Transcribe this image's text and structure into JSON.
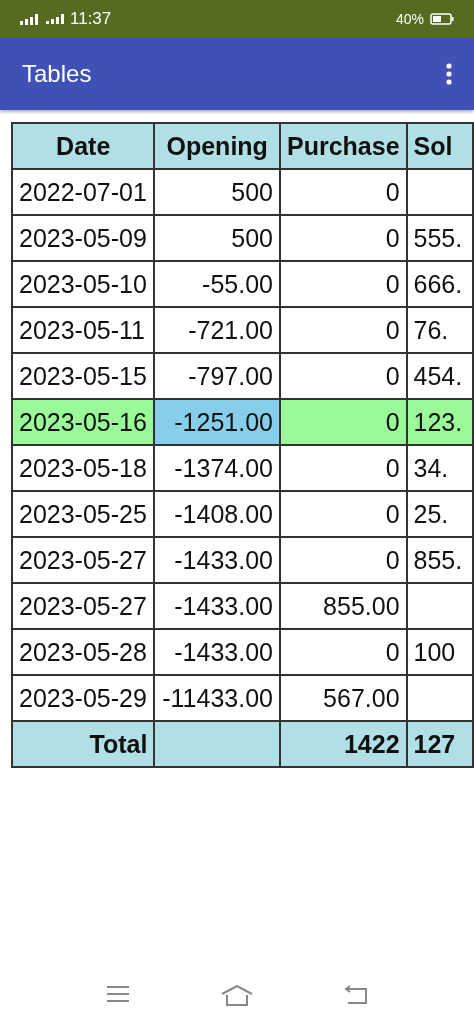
{
  "status_bar": {
    "time": "11:37",
    "battery": "40%"
  },
  "app_bar": {
    "title": "Tables"
  },
  "table": {
    "columns": [
      "Date",
      "Opening",
      "Purchase",
      "Sol"
    ],
    "rows": [
      {
        "date": "2022-07-01",
        "opening": "500",
        "purchase": "0",
        "selected": false,
        "opening_selected": false
      },
      {
        "date": "2023-05-09",
        "opening": "500",
        "purchase": "0",
        "column_4": "555.",
        "selected": false,
        "opening_selected": false
      },
      {
        "date": "2023-05-10",
        "opening": "-55.00",
        "purchase": "0",
        "column_4": "666.",
        "selected": false,
        "opening_selected": false
      },
      {
        "date": "2023-05-11",
        "opening": "-721.00",
        "purchase": "0",
        "column_4": "76.",
        "selected": false,
        "opening_selected": false
      },
      {
        "date": "2023-05-15",
        "opening": "-797.00",
        "purchase": "0",
        "column_4": "454.",
        "selected": false,
        "opening_selected": false
      },
      {
        "date": "2023-05-16",
        "opening": "-1251.00",
        "purchase": "0",
        "column_4": "123.",
        "selected": true,
        "opening_selected": true
      },
      {
        "date": "2023-05-18",
        "opening": "-1374.00",
        "purchase": "0",
        "column_4": "34.",
        "selected": false,
        "opening_selected": false
      },
      {
        "date": "2023-05-25",
        "opening": "-1408.00",
        "purchase": "0",
        "column_4": "25.",
        "selected": false,
        "opening_selected": false
      },
      {
        "date": "2023-05-27",
        "opening": "-1433.00",
        "purchase": "0",
        "column_4": "855.",
        "selected": false,
        "opening_selected": false
      },
      {
        "date": "2023-05-27",
        "opening": "-1433.00",
        "purchase": "855.00",
        "selected": false,
        "opening_selected": false
      },
      {
        "date": "2023-05-28",
        "opening": "-1433.00",
        "purchase": "0",
        "column_4": "100",
        "selected": false,
        "opening_selected": false
      },
      {
        "date": "2023-05-29",
        "opening": "-11433.00",
        "purchase": "567.00",
        "selected": false,
        "opening_selected": false
      }
    ],
    "total": {
      "label": "Total",
      "purchase": "1422",
      "column_4": "127"
    }
  }
}
